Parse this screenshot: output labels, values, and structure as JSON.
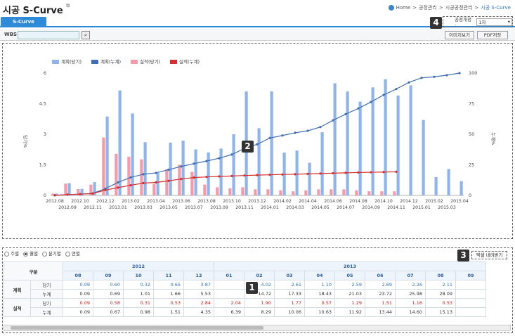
{
  "title": "시공 S-Curve",
  "breadcrumb": {
    "home": "Home",
    "sep": ">",
    "l1": "공정관리",
    "l2": "시공공정관리",
    "current": "시공 S-Curve"
  },
  "tab": "S-Curve",
  "selector": {
    "label": "공정개정 :",
    "value": "1차"
  },
  "toolbar": {
    "wbs_label": "WBS",
    "image_btn": "이미지보기",
    "pdf_btn": "PDF저장"
  },
  "badges": {
    "b1": "1",
    "b2": "2",
    "b3": "3",
    "b4": "4"
  },
  "legend": [
    "계획(당기)",
    "계획(누계)",
    "실적(당기)",
    "실적(누계)"
  ],
  "axis": {
    "left_label": "당기%",
    "right_label": "누계%"
  },
  "colors": {
    "plan_bar": "#8fb4ec",
    "plan_line": "#3f6fb0",
    "actual_bar": "#f59aa6",
    "actual_line": "#d42f2f",
    "accent": "#2f8ad8"
  },
  "chart_data": {
    "type": "bar",
    "categories": [
      "2012.08",
      "2012.09",
      "2012.10",
      "2012.11",
      "2012.12",
      "2013.01",
      "2013.02",
      "2013.03",
      "2013.04",
      "2013.05",
      "2013.06",
      "2013.07",
      "2013.08",
      "2013.09",
      "2013.10",
      "2013.11",
      "2013.12",
      "2014.01",
      "2014.02",
      "2014.03",
      "2014.04",
      "2014.05",
      "2014.06",
      "2014.07",
      "2014.08",
      "2014.09",
      "2014.10",
      "2014.11",
      "2014.12",
      "2015.01",
      "2015.02",
      "2015.03",
      "2015.04"
    ],
    "series": [
      {
        "name": "계획(당기)",
        "values": [
          0.09,
          0.6,
          0.32,
          0.65,
          3.87,
          5.15,
          4.02,
          2.61,
          1.1,
          2.59,
          2.69,
          2.26,
          2.11,
          2.3,
          3.0,
          5.1,
          3.3,
          5.1,
          2.1,
          2.2,
          1.6,
          3.1,
          5.5,
          5.1,
          4.6,
          5.3,
          5.7,
          4.9,
          5.4,
          3.7,
          0.9,
          1.3,
          0.7
        ]
      },
      {
        "name": "계획(누계)",
        "values": [
          0.09,
          0.69,
          1.01,
          1.66,
          5.53,
          10.68,
          14.7,
          17.33,
          18.43,
          21.03,
          23.72,
          25.98,
          28.09,
          30.4,
          33.4,
          38.5,
          41.8,
          46.9,
          49.0,
          51.2,
          52.8,
          55.9,
          61.4,
          66.5,
          71.1,
          76.4,
          82.1,
          87.0,
          92.4,
          96.1,
          97.0,
          98.3,
          100
        ]
      },
      {
        "name": "실적(당기)",
        "values": [
          0.09,
          0.58,
          0.31,
          0.53,
          2.84,
          2.04,
          1.9,
          1.77,
          0.57,
          1.29,
          1.51,
          1.16,
          0.53,
          0.4,
          0.35,
          0.4,
          0.3,
          0.3,
          0.25,
          0.2,
          0.25,
          0.3,
          0.3,
          0.3,
          0.25,
          0.2,
          0.2,
          0.2
        ]
      },
      {
        "name": "실적(누계)",
        "values": [
          0.09,
          0.67,
          0.98,
          1.51,
          4.35,
          6.39,
          8.29,
          10.06,
          10.63,
          11.92,
          13.44,
          14.6,
          15.13,
          15.53,
          15.88,
          16.28,
          16.58,
          16.88,
          17.13,
          17.33,
          17.58,
          17.88,
          18.18,
          18.48,
          18.73,
          18.93,
          19.13,
          19.33
        ]
      }
    ],
    "y_left_ticks": [
      "0",
      "1.5",
      "3",
      "4.5",
      "6"
    ],
    "y_right_ticks": [
      "0",
      "25",
      "50",
      "75",
      "100"
    ],
    "ylim_left": [
      0,
      6
    ],
    "ylim_right": [
      0,
      100
    ]
  },
  "filter": {
    "options": [
      "주별",
      "월별",
      "분기별",
      "연별"
    ],
    "selected": 1,
    "excel_btn": "엑셀 내려받기"
  },
  "table": {
    "header_col": "구분",
    "years": [
      {
        "label": "2012",
        "span": 5
      },
      {
        "label": "2013",
        "span": 9
      }
    ],
    "months": [
      "08",
      "09",
      "10",
      "11",
      "12",
      "01",
      "02",
      "03",
      "04",
      "05",
      "06",
      "07",
      "08",
      "09"
    ],
    "rows": [
      {
        "group": "계획",
        "type": "당기",
        "values": [
          "0.09",
          "0.60",
          "0.32",
          "0.65",
          "3.87",
          "",
          "4.02",
          "2.61",
          "1.10",
          "2.59",
          "2.69",
          "2.26",
          "2.11",
          ""
        ]
      },
      {
        "group": "",
        "type": "누계",
        "values": [
          "0.09",
          "0.69",
          "1.01",
          "1.66",
          "5.53",
          "",
          "14.72",
          "17.33",
          "18.43",
          "21.03",
          "23.72",
          "25.98",
          "28.09",
          ""
        ]
      },
      {
        "group": "실적",
        "type": "당기",
        "values": [
          "0.09",
          "0.58",
          "0.31",
          "0.53",
          "2.84",
          "2.04",
          "1.90",
          "1.77",
          "0.57",
          "1.29",
          "1.51",
          "1.16",
          "0.53",
          ""
        ]
      },
      {
        "group": "",
        "type": "누계",
        "values": [
          "0.09",
          "0.67",
          "0.98",
          "1.51",
          "4.35",
          "6.39",
          "8.29",
          "10.06",
          "10.63",
          "11.92",
          "13.44",
          "14.60",
          "15.13",
          ""
        ]
      }
    ]
  }
}
